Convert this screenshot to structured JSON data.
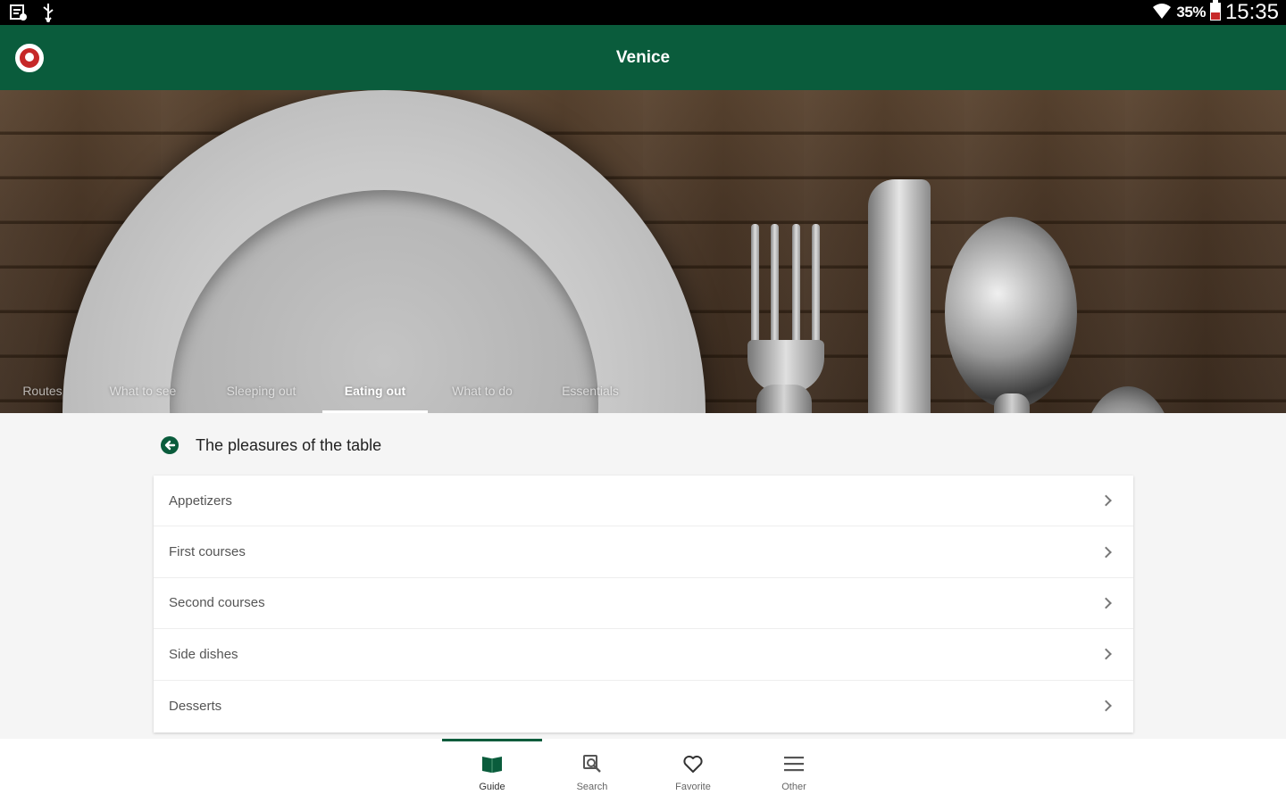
{
  "status_bar": {
    "battery_percent": "35%",
    "time": "15:35"
  },
  "app_bar": {
    "title": "Venice"
  },
  "tabs": [
    {
      "label": "Routes",
      "active": false
    },
    {
      "label": "What to see",
      "active": false
    },
    {
      "label": "Sleeping out",
      "active": false
    },
    {
      "label": "Eating out",
      "active": true
    },
    {
      "label": "What to do",
      "active": false
    },
    {
      "label": "Essentials",
      "active": false
    }
  ],
  "section": {
    "title": "The pleasures of the table"
  },
  "list": [
    {
      "label": "Appetizers"
    },
    {
      "label": "First courses"
    },
    {
      "label": "Second courses"
    },
    {
      "label": "Side dishes"
    },
    {
      "label": "Desserts"
    }
  ],
  "bottom_nav": [
    {
      "label": "Guide",
      "icon": "book-icon",
      "active": true
    },
    {
      "label": "Search",
      "icon": "search-icon",
      "active": false
    },
    {
      "label": "Favorite",
      "icon": "heart-icon",
      "active": false
    },
    {
      "label": "Other",
      "icon": "menu-icon",
      "active": false
    }
  ],
  "colors": {
    "brand": "#0a5c3c",
    "background": "#f5f5f5"
  }
}
